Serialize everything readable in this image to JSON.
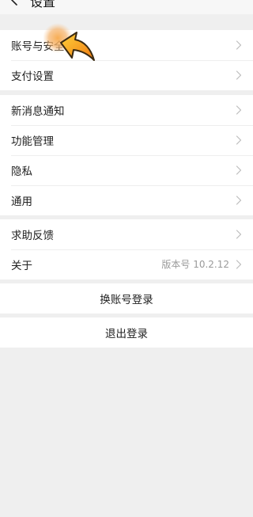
{
  "header": {
    "title": "设置",
    "back_icon": "chevron-left-icon"
  },
  "groups": [
    {
      "items": [
        {
          "label": "账号与安全"
        },
        {
          "label": "支付设置"
        }
      ]
    },
    {
      "items": [
        {
          "label": "新消息通知"
        },
        {
          "label": "功能管理"
        },
        {
          "label": "隐私"
        },
        {
          "label": "通用"
        }
      ]
    },
    {
      "items": [
        {
          "label": "求助反馈"
        },
        {
          "label": "关于",
          "value": "版本号 10.2.12"
        }
      ]
    }
  ],
  "actions": {
    "switch_account": "换账号登录",
    "logout": "退出登录"
  },
  "colors": {
    "background": "#efefef",
    "surface": "#ffffff",
    "divider": "#eeeeee",
    "secondary_text": "#9a9a9a",
    "chevron": "#bdbdbd",
    "highlight_orange": "#f39a1e"
  },
  "overlay": {
    "icon": "tap-arrow-icon"
  }
}
